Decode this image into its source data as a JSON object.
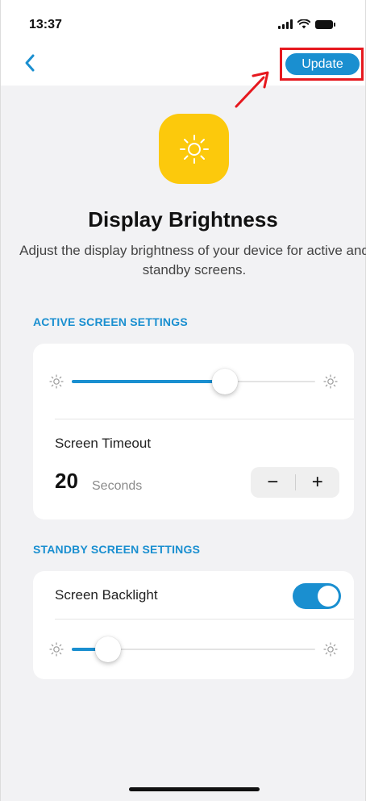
{
  "status_bar": {
    "time": "13:37"
  },
  "nav": {
    "back_icon": "chevron-left-icon",
    "update_label": "Update"
  },
  "hero": {
    "icon": "sun-icon",
    "title": "Display Brightness",
    "description": "Adjust the display brightness of your device for active and standby screens."
  },
  "active_screen": {
    "heading": "ACTIVE SCREEN SETTINGS",
    "brightness_level": 0.63,
    "timeout_label": "Screen Timeout",
    "timeout_value": "20",
    "timeout_unit": "Seconds",
    "decrement_label": "−",
    "increment_label": "+"
  },
  "standby_screen": {
    "heading": "STANDBY SCREEN SETTINGS",
    "backlight_label": "Screen Backlight",
    "backlight_on": true,
    "brightness_level": 0.15
  },
  "colors": {
    "accent": "#1a8fd0",
    "hero_icon_bg": "#fcc90c",
    "annotation": "#e6181e",
    "background": "#f2f2f4"
  }
}
